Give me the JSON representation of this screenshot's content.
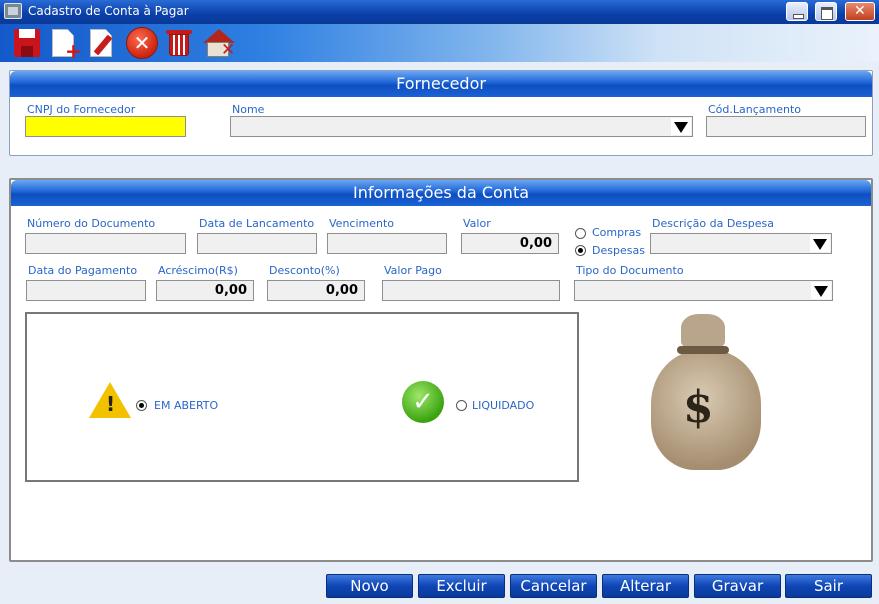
{
  "window": {
    "title": "Cadastro de Conta à Pagar"
  },
  "toolbar": {
    "icons": [
      "save-icon",
      "new-document-icon",
      "edit-document-icon",
      "cancel-icon",
      "trash-icon",
      "home-close-icon"
    ]
  },
  "fornecedor": {
    "header": "Fornecedor",
    "cnpj_label": "CNPJ do Fornecedor",
    "cnpj_value": "",
    "nome_label": "Nome",
    "nome_value": "",
    "cod_label": "Cód.Lançamento",
    "cod_value": ""
  },
  "conta": {
    "header": "Informações da Conta",
    "numero_label": "Número do Documento",
    "numero_value": "",
    "data_lanc_label": "Data de Lancamento",
    "data_lanc_value": "",
    "vencimento_label": "Vencimento",
    "vencimento_value": "",
    "valor_label": "Valor",
    "valor_value": "0,00",
    "radio_compras": "Compras",
    "radio_despesas": "Despesas",
    "selected_tipo": "Despesas",
    "descricao_label": "Descrição da Despesa",
    "descricao_value": "",
    "data_pag_label": "Data do Pagamento",
    "data_pag_value": "",
    "acrescimo_label": "Acréscimo(R$)",
    "acrescimo_value": "0,00",
    "desconto_label": "Desconto(%)",
    "desconto_value": "0,00",
    "valor_pago_label": "Valor Pago",
    "valor_pago_value": "",
    "tipo_doc_label": "Tipo do Documento",
    "tipo_doc_value": ""
  },
  "status": {
    "em_aberto": "EM ABERTO",
    "liquidado": "LIQUIDADO",
    "selected": "EM ABERTO"
  },
  "colors": {
    "accent": "#1d64d8",
    "label": "#2a66c8",
    "highlight": "#ffff00"
  },
  "buttons": {
    "novo": "Novo",
    "excluir": "Excluir",
    "cancelar": "Cancelar",
    "alterar": "Alterar",
    "gravar": "Gravar",
    "sair": "Sair"
  }
}
